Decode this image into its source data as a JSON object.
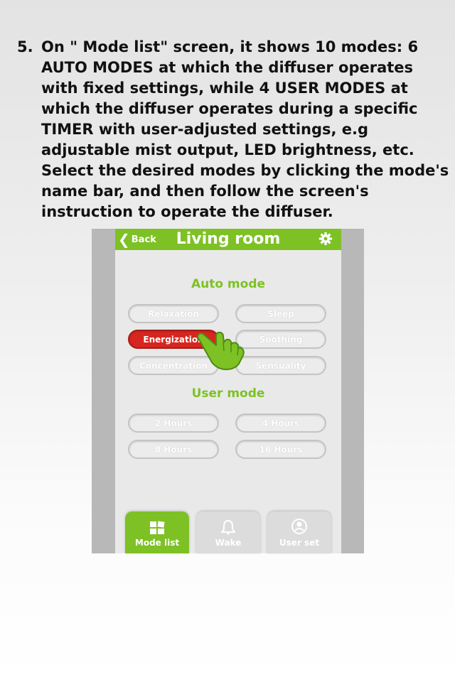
{
  "instruction": {
    "step_number": "5.",
    "text": "On \" Mode list\" screen, it shows 10 modes: 6 AUTO MODES at which the diffuser operates with fixed settings, while 4 USER MODES at which the diffuser operates during a specific TIMER with user-adjusted settings, e.g adjustable mist output, LED brightness, etc. Select the desired modes by clicking the mode's name bar, and then follow the screen's instruction to operate the diffuser."
  },
  "app": {
    "back_label": "Back",
    "title": "Living room",
    "settings_icon": "gear-icon",
    "accent_color": "#7ec125",
    "active_color": "#d7261f"
  },
  "auto_mode": {
    "heading": "Auto mode",
    "buttons": [
      "Relaxation",
      "Sleep",
      "Energization",
      "Soothing",
      "Concentration",
      "Sensuality"
    ],
    "selected": "Energization"
  },
  "user_mode": {
    "heading": "User mode",
    "buttons": [
      "2 Hours",
      "4 Hours",
      "8 Hours",
      "16 Hours"
    ]
  },
  "tabs": [
    {
      "label": "Mode list",
      "icon": "grid-icon",
      "active": true
    },
    {
      "label": "Wake",
      "icon": "bell-icon",
      "active": false
    },
    {
      "label": "User set",
      "icon": "user-icon",
      "active": false
    }
  ]
}
